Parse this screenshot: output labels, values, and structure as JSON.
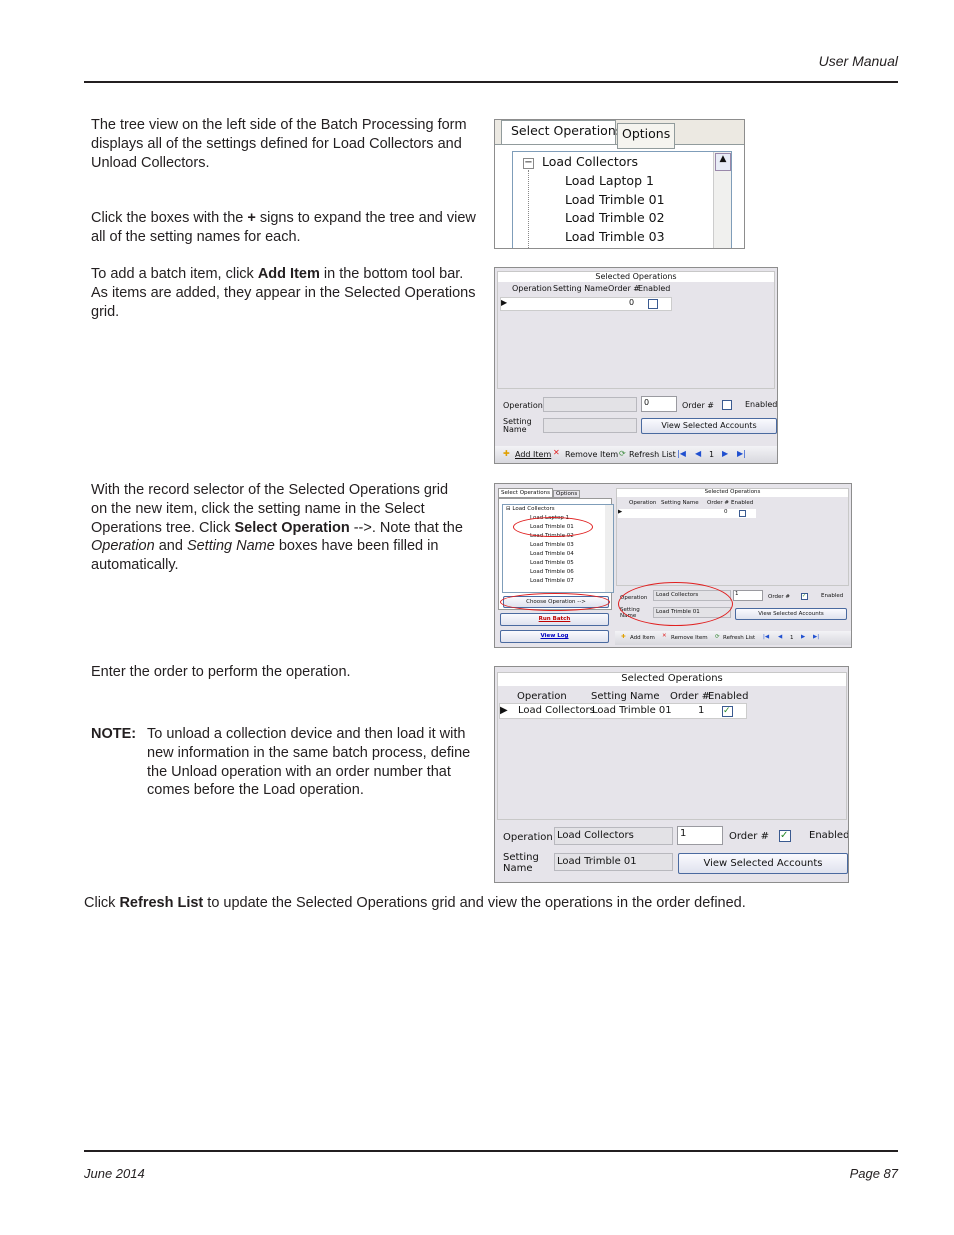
{
  "header": {
    "title": "User Manual"
  },
  "footer": {
    "date": "June 2014",
    "page": "Page 87"
  },
  "paragraphs": {
    "p1": "The tree view on the left side of the Batch Processing form displays all of the settings defined for Load Collectors and Unload Collectors.",
    "p2a": "Click the boxes with the ",
    "p2b": "+",
    "p2c": " signs to expand the tree and view all of the setting names for each.",
    "p3a": "To add a batch item, click ",
    "p3b": "Add Item",
    "p3c": " in the bottom tool bar. As items are added, they appear in the Selected Operations grid.",
    "p4a": "With the record selector of the Selected Operations grid on the new item, click the setting name in the Select Operations tree. Click ",
    "p4b": "Select Operation",
    "p4c": " -->. Note that the ",
    "p4d": "Operation",
    "p4e": " and ",
    "p4f": "Setting Name",
    "p4g": " boxes have been filled in automatically.",
    "p5": "Enter the order to perform the operation.",
    "note_label": "NOTE:",
    "note": "To unload a collection device and then load it with new information in the same batch process, define the Unload operation with an order number that comes before the Load operation.",
    "p6a": "Click ",
    "p6b": "Refresh List",
    "p6c": " to update the Selected Operations grid and view the operations in the order defined."
  },
  "ui": {
    "tab_select": "Select Operations",
    "tab_options": "Options",
    "tree_root": "Load Collectors",
    "tree_items": [
      "Load Laptop 1",
      "Load Trimble 01",
      "Load Trimble 02",
      "Load Trimble 03",
      "Load Trimble 04",
      "Load Trimble 05",
      "Load Trimble 06",
      "Load Trimble 07"
    ],
    "grid_title": "Selected Operations",
    "columns": [
      "Operation",
      "Setting Name",
      "Order #",
      "Enabled"
    ],
    "lbl_operation": "Operation",
    "lbl_setting1": "Setting",
    "lbl_setting2": "Name",
    "lbl_order": "Order #",
    "lbl_enabled": "Enabled",
    "view_accounts": "View Selected Accounts",
    "add_item": "Add Item",
    "remove_item": "Remove Item",
    "refresh_list": "Refresh List",
    "page_num": "1",
    "choose_operation": "Choose Operation -->",
    "run_batch": "Run Batch",
    "view_log": "View Log",
    "order_empty": "0",
    "order_one": "1",
    "op_value": "Load Collectors",
    "setting_value": "Load Trimble 01",
    "highlight_color": "#e02020"
  }
}
